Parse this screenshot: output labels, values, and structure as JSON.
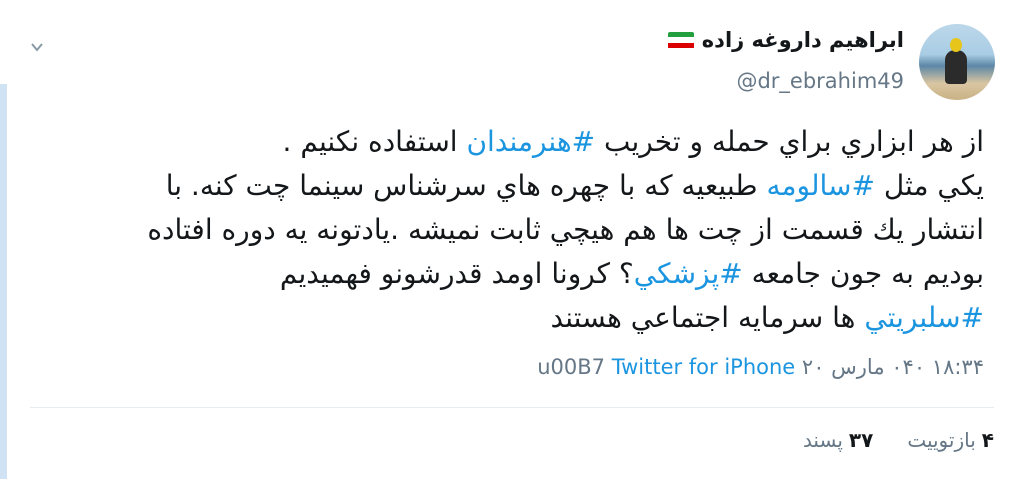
{
  "user": {
    "name": "ابراهیم داروغه زاده",
    "handle": "@dr_ebrahim49",
    "flag_colors": [
      "#239f40",
      "#ffffff",
      "#da0000"
    ]
  },
  "tweet": {
    "line1_pre": "از هر ابزاري براي حمله و تخريب ",
    "tag1": "#هنرمندان",
    "line1_post": " استفاده نكنيم .",
    "line2_pre": "يكي مثل ",
    "tag2": "#سالومه",
    "line2_post": " طبيعيه كه با چهره هاي سرشناس سينما چت كنه. با",
    "line3": "انتشار يك قسمت از چت ها هم هيچي ثابت نميشه .يادتونه يه دوره افتاده",
    "line4_pre": "بوديم به جون جامعه ",
    "tag4": "#پزشكي",
    "line4_post": "؟ كرونا اومد قدرشونو فهميديم",
    "tag5": "#سلبريتي",
    "line5_post": " ها سرمايه اجتماعي هستند"
  },
  "meta": {
    "time_date": "۱۸:۳۴ ۰۴۰ مارس ۲۰ u00B7",
    "source": "Twitter for iPhone"
  },
  "stats": {
    "retweets_count": "۴",
    "retweets_label": "بازتوییت",
    "likes_count": "۳۷",
    "likes_label": "پسند"
  },
  "colors": {
    "link": "#1b95e0",
    "muted": "#657786",
    "edge": "#cfe3f5"
  }
}
